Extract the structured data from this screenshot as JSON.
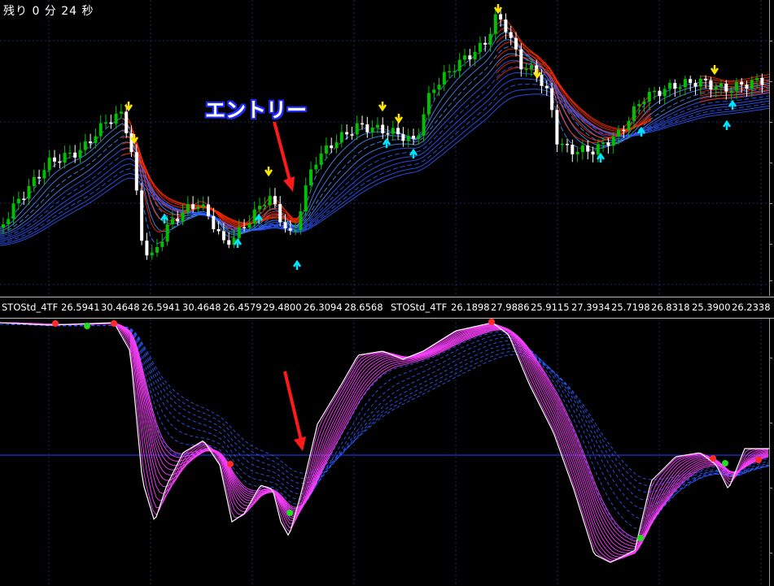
{
  "timer": {
    "label": "残り 0 分 24 秒"
  },
  "annotation": {
    "entry_text": "エントリー"
  },
  "indicator_header": {
    "segments": [
      "STOStd_4TF",
      "26.5941",
      "30.4648",
      "26.5941",
      "30.4648",
      "26.4579",
      "29.4800",
      "26.3094",
      "28.6568",
      "STOStd_4TF",
      "26.1898",
      "27.9886",
      "25.9115",
      "27.3934",
      "25.7198",
      "26.8318",
      "25.3900",
      "26.2338"
    ]
  },
  "colors": {
    "bull_candle": "#00c000",
    "bear_candle": "#ffffff",
    "up_arrow": "#00e5ff",
    "down_arrow": "#ffe600",
    "ma_red": "#ff2a00",
    "ma_blue": "#2d5bff",
    "stoch_white": "#ffffff",
    "stoch_magenta": "#ff40ff",
    "entry_arrow": "#ff1a1a",
    "label_outline": "#1f2bff",
    "grid": "#1a2a6b"
  },
  "icons": {
    "buy": "up-arrow-icon",
    "sell": "down-arrow-icon",
    "entry": "red-arrow-icon"
  }
}
